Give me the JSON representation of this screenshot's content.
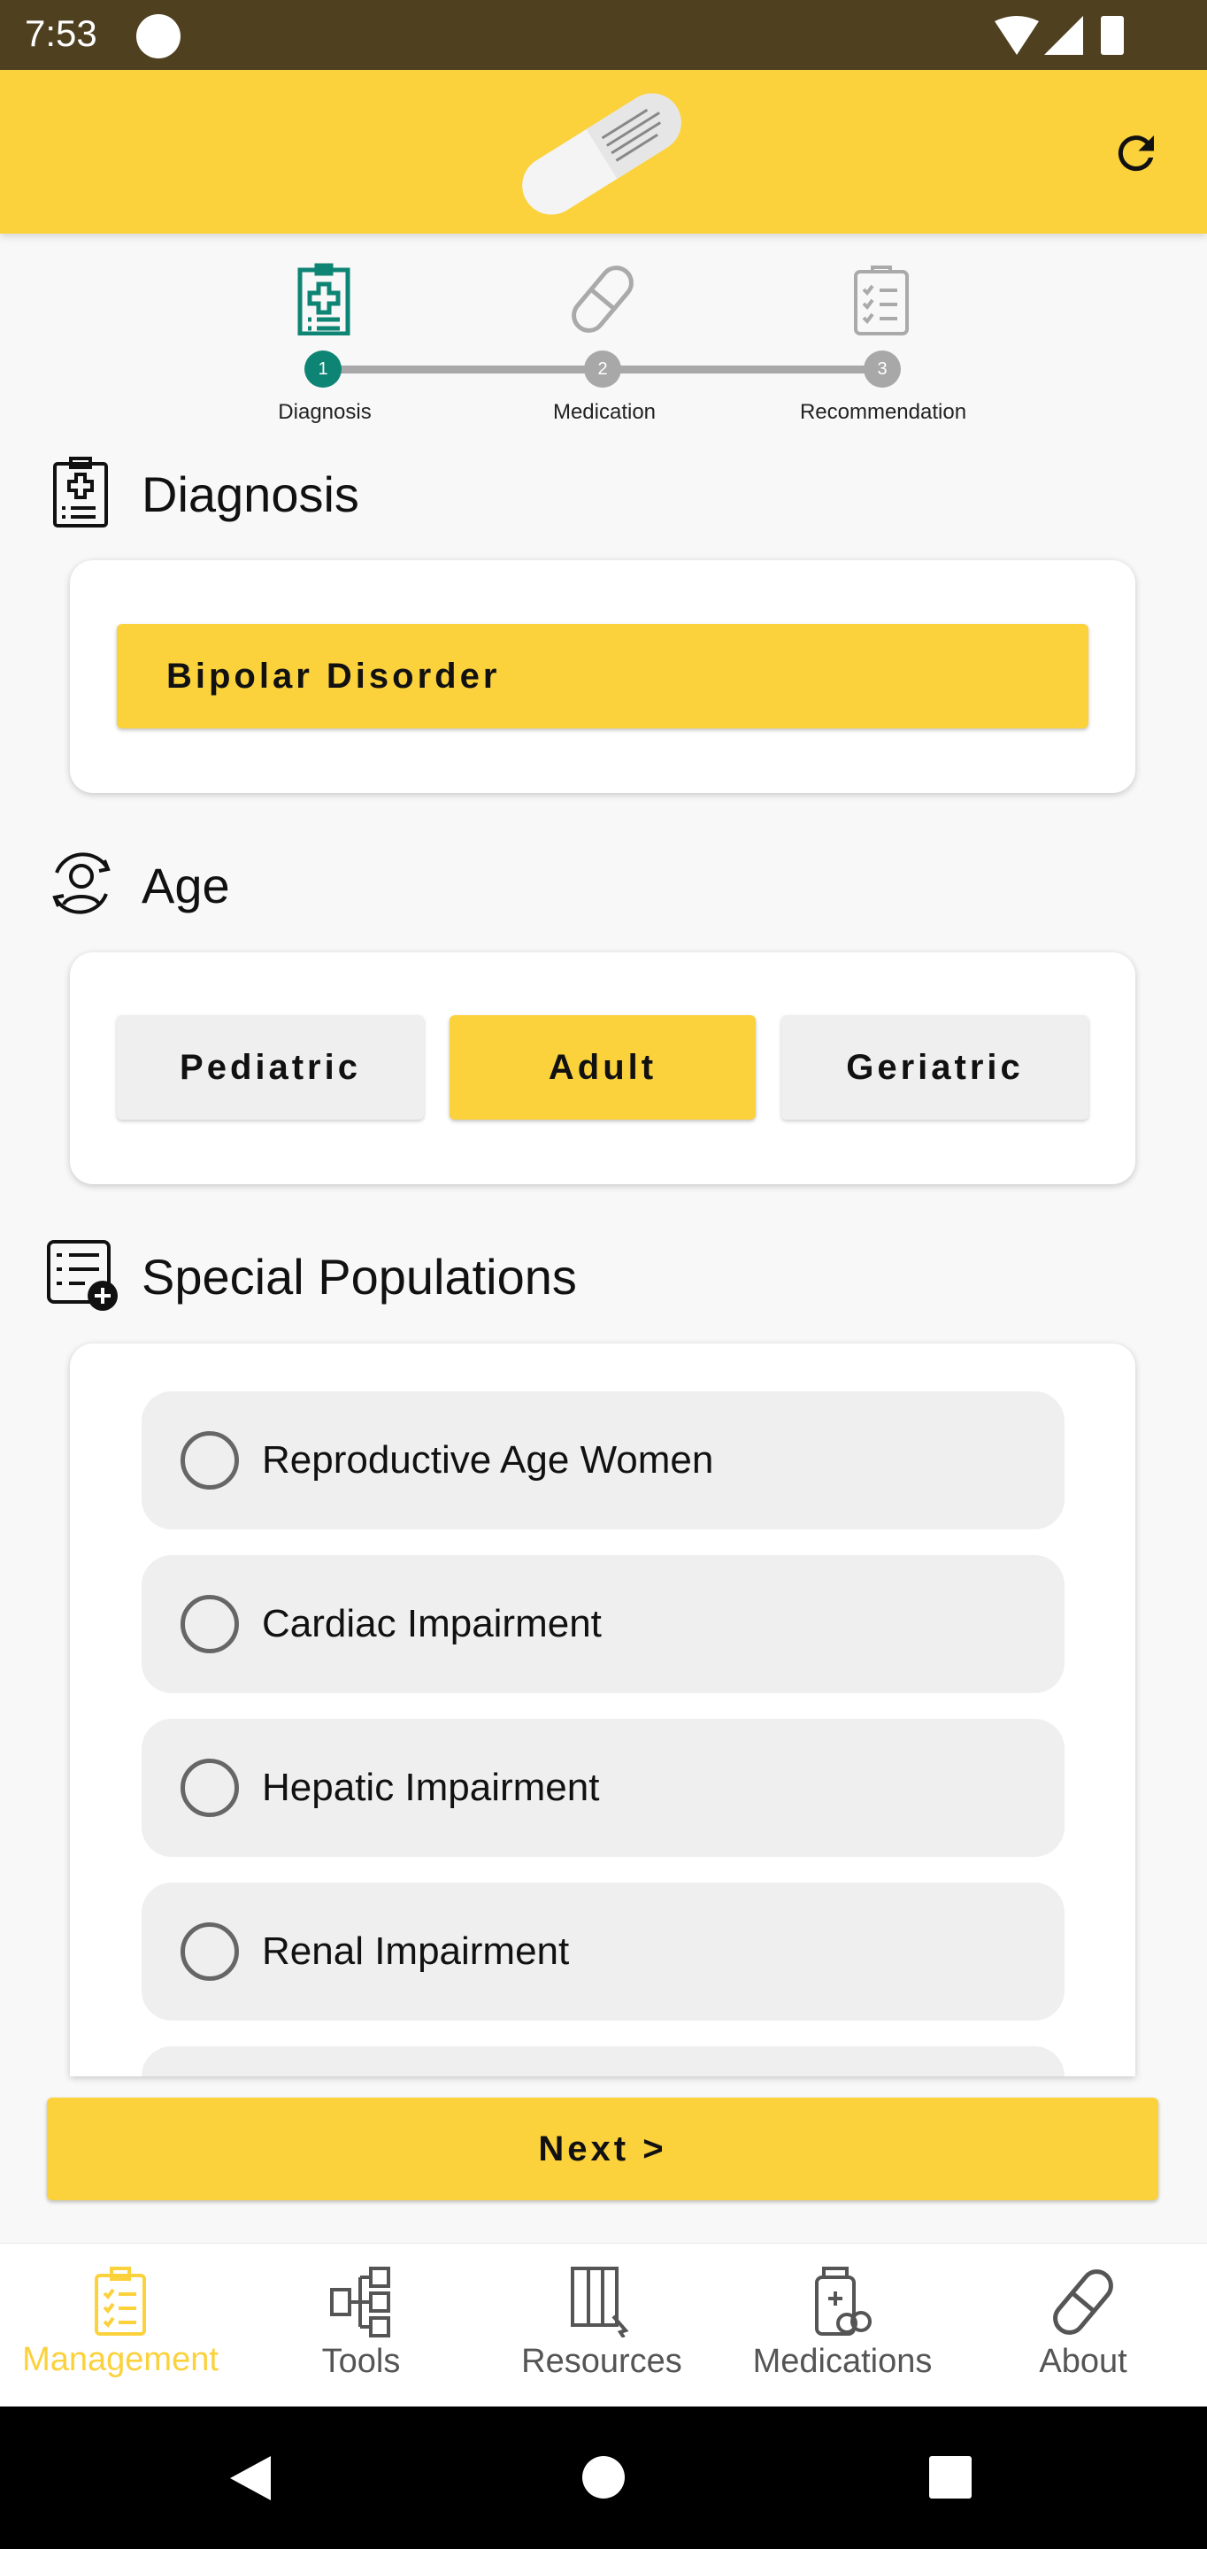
{
  "status_bar": {
    "time": "7:53"
  },
  "header": {
    "logo": "capsule-logo",
    "refresh_icon": "refresh-icon"
  },
  "stepper": {
    "steps": [
      {
        "number": "1",
        "label": "Diagnosis",
        "active": true
      },
      {
        "number": "2",
        "label": "Medication",
        "active": false
      },
      {
        "number": "3",
        "label": "Recommendation",
        "active": false
      }
    ],
    "active_color": "#0e8574",
    "inactive_color": "#a8a8a8"
  },
  "diagnosis": {
    "title": "Diagnosis",
    "selected": "Bipolar Disorder"
  },
  "age": {
    "title": "Age",
    "options": [
      "Pediatric",
      "Adult",
      "Geriatric"
    ],
    "selected": "Adult"
  },
  "special_populations": {
    "title": "Special Populations",
    "options": [
      "Reproductive Age Women",
      "Cardiac Impairment",
      "Hepatic Impairment",
      "Renal Impairment"
    ]
  },
  "next_button": "Next >",
  "bottom_nav": {
    "items": [
      "Management",
      "Tools",
      "Resources",
      "Medications",
      "About"
    ],
    "active": "Management",
    "active_color": "#fbd13c"
  },
  "colors": {
    "accent": "#fbd13c",
    "status_bar": "#4f4020"
  }
}
